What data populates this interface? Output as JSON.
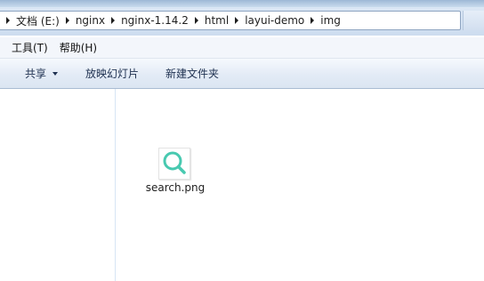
{
  "address": {
    "breadcrumbs": [
      "文档 (E:)",
      "nginx",
      "nginx-1.14.2",
      "html",
      "layui-demo",
      "img"
    ]
  },
  "menu": {
    "items": [
      "工具(T)",
      "帮助(H)"
    ]
  },
  "toolbar": {
    "share_label": "共享",
    "slideshow_label": "放映幻灯片",
    "new_folder_label": "新建文件夹"
  },
  "files": [
    {
      "name": "search.png",
      "icon": "search-icon",
      "icon_color": "#48c9b0"
    }
  ],
  "colors": {
    "accent": "#48c9b0",
    "toolbar_text": "#1e3050",
    "address_border": "#8ea4c1"
  }
}
